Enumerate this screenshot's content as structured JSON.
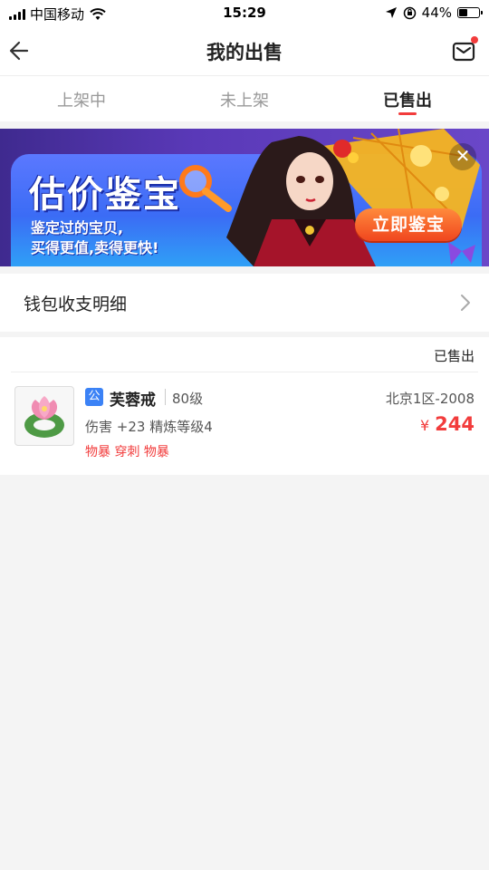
{
  "status_bar": {
    "carrier": "中国移动",
    "time": "15:29",
    "battery": "44%",
    "battery_level": 0.44,
    "icons": [
      "signal-icon",
      "wifi-icon",
      "location-icon",
      "orientation-lock-icon",
      "battery-icon"
    ]
  },
  "nav": {
    "title": "我的出售",
    "back_icon": "back-arrow-icon",
    "mail_icon": "mail-icon",
    "accent": "#f23c3c"
  },
  "tabs": [
    {
      "label": "上架中",
      "active": false
    },
    {
      "label": "未上架",
      "active": false
    },
    {
      "label": "已售出",
      "active": true
    }
  ],
  "banner": {
    "title": "估价鉴宝",
    "subtitle_line1": "鉴定过的宝贝,",
    "subtitle_line2": "买得更值,卖得更快!",
    "cta": "立即鉴宝",
    "close_icon": "close-icon"
  },
  "wallet": {
    "label": "钱包收支明细"
  },
  "sold_list": {
    "status": "已售出",
    "items": [
      {
        "badge": "公",
        "name": "芙蓉戒",
        "level": "80级",
        "server": "北京1区-2008",
        "attrs": "伤害 +23 精炼等级4",
        "currency": "¥",
        "price": "244",
        "tags": "物暴 穿刺 物暴",
        "image_icon": "lotus-ring-icon"
      }
    ]
  },
  "colors": {
    "accent_red": "#f23c3c",
    "badge_blue": "#3b82f6",
    "background": "#f4f4f4"
  }
}
